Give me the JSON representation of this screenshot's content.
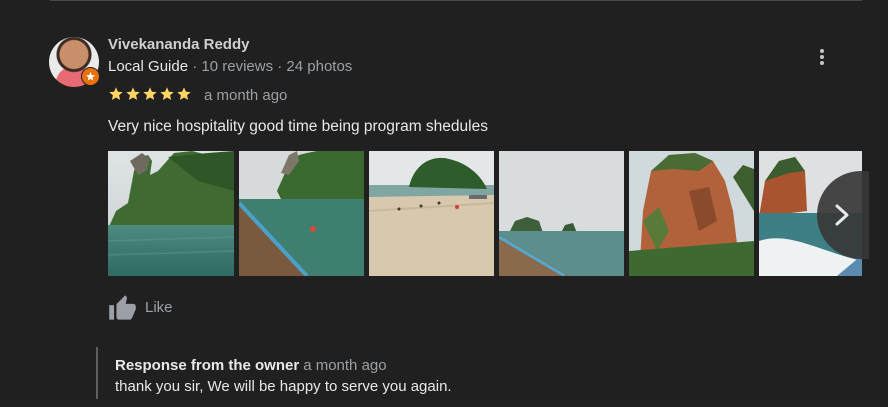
{
  "review": {
    "reviewer_name": "Vivekananda Reddy",
    "guide_label": "Local Guide",
    "stats": " · 10 reviews · 24 photos",
    "rating": 5,
    "date": "a month ago",
    "text": "Very nice hospitality good time being program shedules",
    "photos": [
      {
        "scene": "rock-islet-cliff"
      },
      {
        "scene": "boat-bow-cliff"
      },
      {
        "scene": "beach-island"
      },
      {
        "scene": "boat-bow-sea"
      },
      {
        "scene": "orange-cliff"
      },
      {
        "scene": "boat-wake-rock"
      }
    ],
    "like_label": "Like"
  },
  "owner_response": {
    "label": "Response from the owner",
    "date": "a month ago",
    "text": "thank you sir, We will be happy to serve you again."
  },
  "colors": {
    "background": "#202020",
    "star": "#fdd663",
    "badge": "#e8710a",
    "muted_text": "#9aa0a6",
    "text": "#e8e8e8"
  },
  "icons": [
    "local-guide-badge-icon",
    "more-vert-icon",
    "star-icon",
    "chevron-right-icon",
    "thumb-up-icon"
  ]
}
